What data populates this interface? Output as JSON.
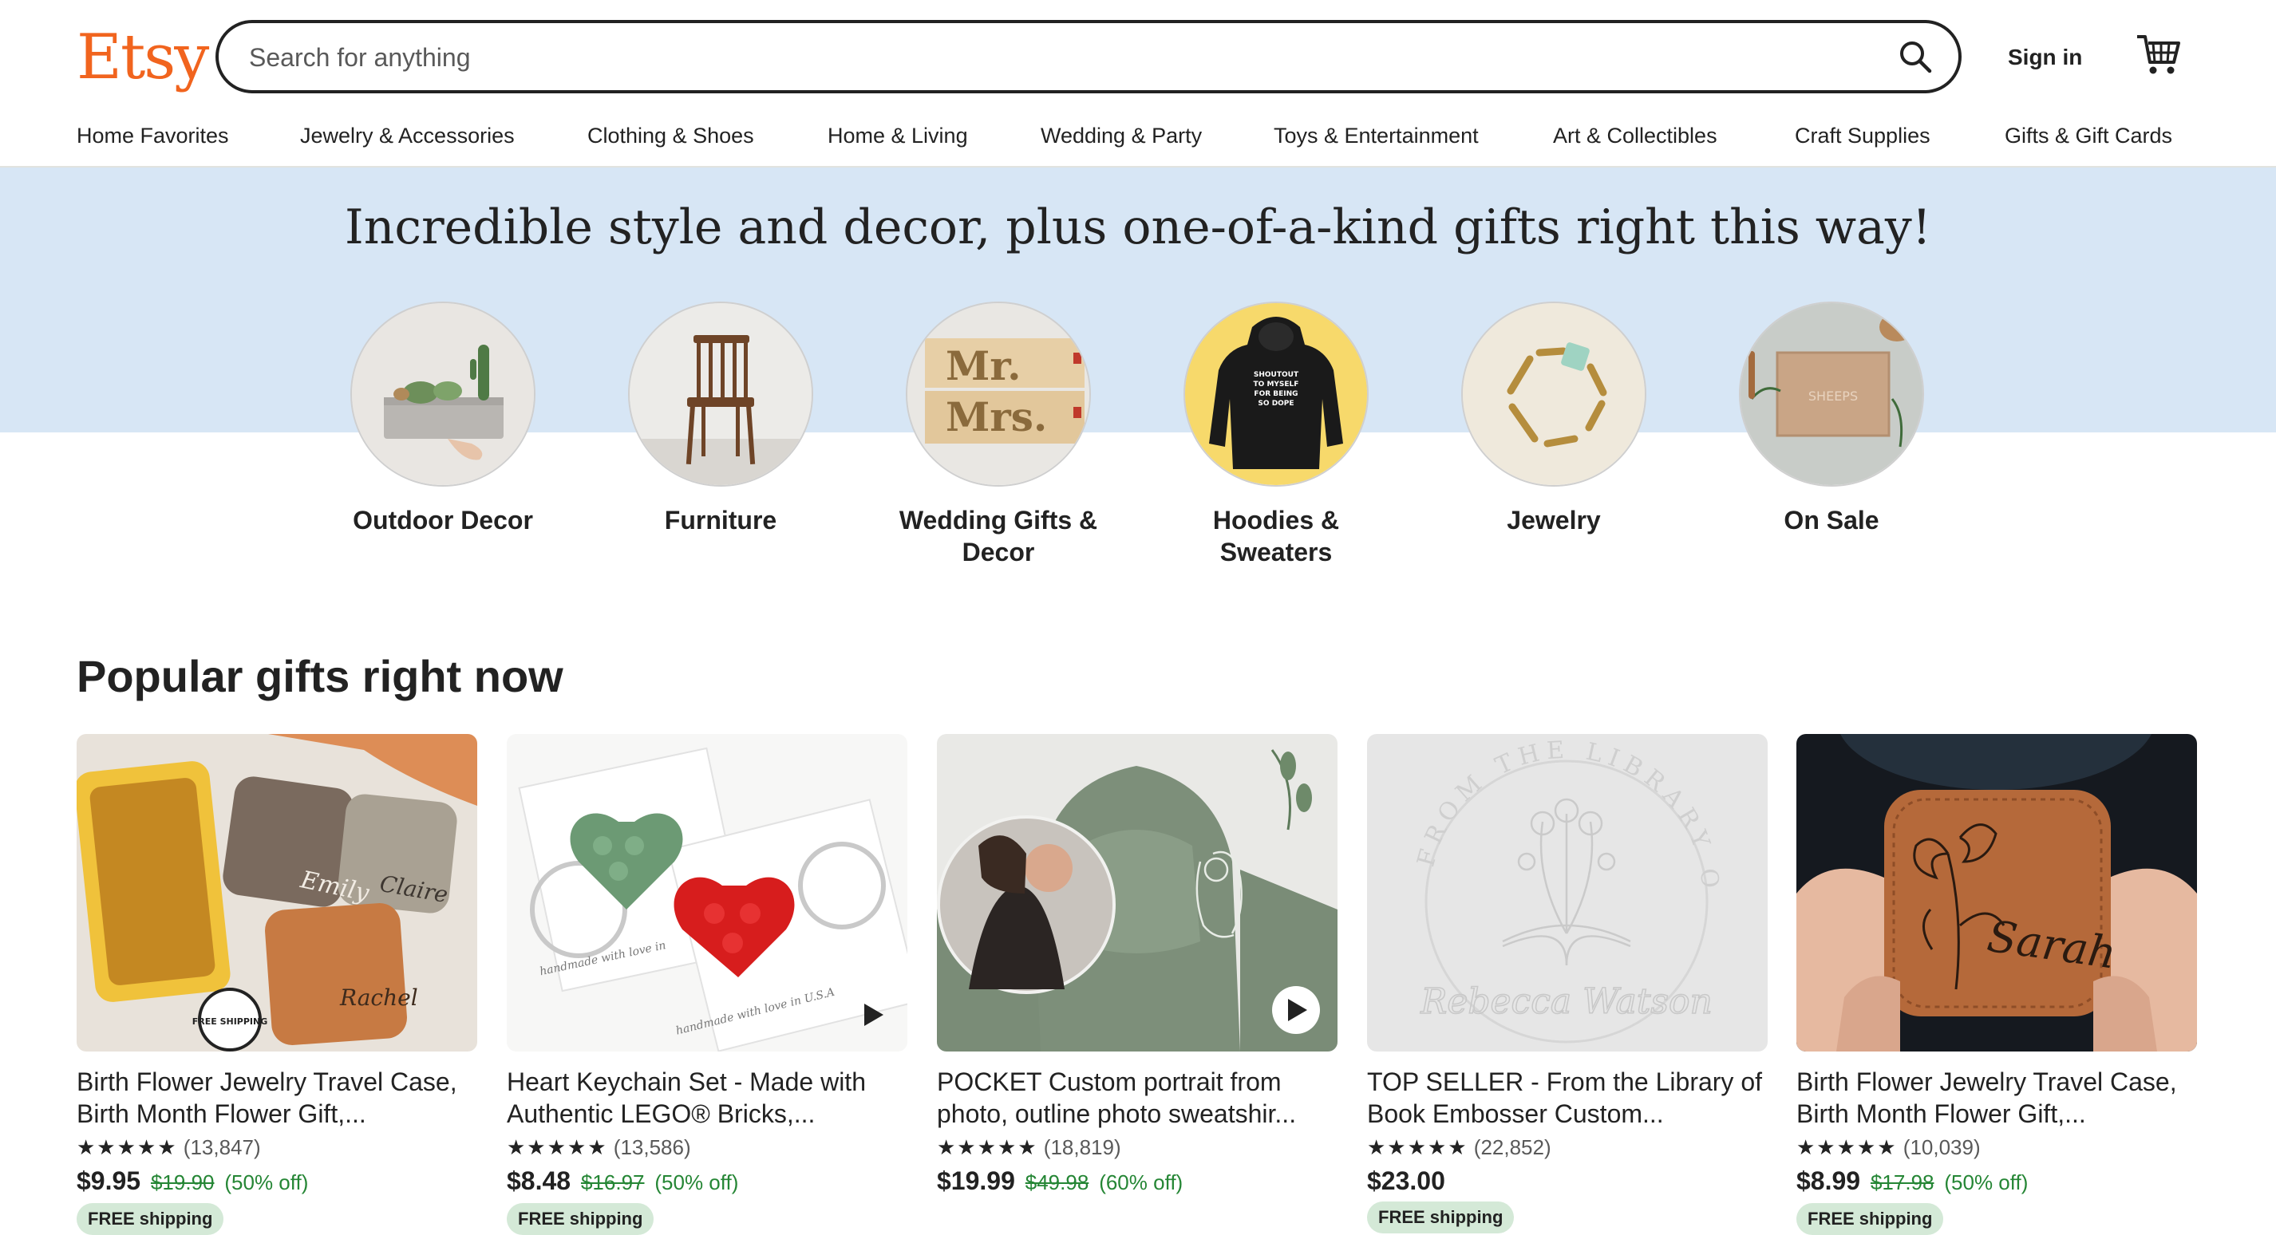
{
  "header": {
    "logo": "Etsy",
    "search_placeholder": "Search for anything",
    "sign_in": "Sign in"
  },
  "nav": [
    "Home Favorites",
    "Jewelry & Accessories",
    "Clothing & Shoes",
    "Home & Living",
    "Wedding & Party",
    "Toys & Entertainment",
    "Art & Collectibles",
    "Craft Supplies",
    "Gifts & Gift Cards"
  ],
  "hero": {
    "title": "Incredible style and decor, plus one-of-a-kind gifts right this way!",
    "categories": [
      {
        "label": "Outdoor Decor"
      },
      {
        "label": "Furniture"
      },
      {
        "label": "Wedding Gifts & Decor"
      },
      {
        "label": "Hoodies & Sweaters",
        "image_text": "SHOUTOUT TO MYSELF FOR BEING SO DOPE"
      },
      {
        "label": "Jewelry"
      },
      {
        "label": "On Sale",
        "image_text": "SHEEPS"
      }
    ],
    "wedding_sign": {
      "line1": "Mr.",
      "line2": "Mrs."
    }
  },
  "popular": {
    "title": "Popular gifts right now",
    "items": [
      {
        "title": "Birth Flower Jewelry Travel Case, Birth Month Flower Gift,...",
        "stars": "★★★★★",
        "reviews": "(13,847)",
        "price": "$9.95",
        "original": "$19.90",
        "discount": "(50% off)",
        "badge": "FREE shipping",
        "image_text": [
          "Emily",
          "Claire",
          "Rachel",
          "FREE SHIPPING"
        ]
      },
      {
        "title": "Heart Keychain Set - Made with Authentic LEGO® Bricks,...",
        "stars": "★★★★★",
        "reviews": "(13,586)",
        "price": "$8.48",
        "original": "$16.97",
        "discount": "(50% off)",
        "badge": "FREE shipping",
        "image_text": [
          "handmade with love in",
          "handmade with love in U.S.A"
        ]
      },
      {
        "title": "POCKET Custom portrait from photo, outline photo sweatshir...",
        "stars": "★★★★★",
        "reviews": "(18,819)",
        "price": "$19.99",
        "original": "$49.98",
        "discount": "(60% off)",
        "badge": ""
      },
      {
        "title": "TOP SELLER - From the Library of Book Embosser Custom...",
        "stars": "★★★★★",
        "reviews": "(22,852)",
        "price": "$23.00",
        "original": "",
        "discount": "",
        "badge": "FREE shipping",
        "image_text": [
          "FROM THE LIBRARY OF",
          "Rebecca Watson"
        ]
      },
      {
        "title": "Birth Flower Jewelry Travel Case, Birth Month Flower Gift,...",
        "stars": "★★★★★",
        "reviews": "(10,039)",
        "price": "$8.99",
        "original": "$17.98",
        "discount": "(50% off)",
        "badge": "FREE shipping",
        "image_text": [
          "Sarah"
        ]
      }
    ]
  },
  "colors": {
    "brand": "#f1641e",
    "hero_bg": "#d7e6f5",
    "sale_green": "#258635",
    "badge_bg": "#d4e9d7"
  },
  "icons": [
    "search-icon",
    "cart-icon",
    "play-icon"
  ]
}
